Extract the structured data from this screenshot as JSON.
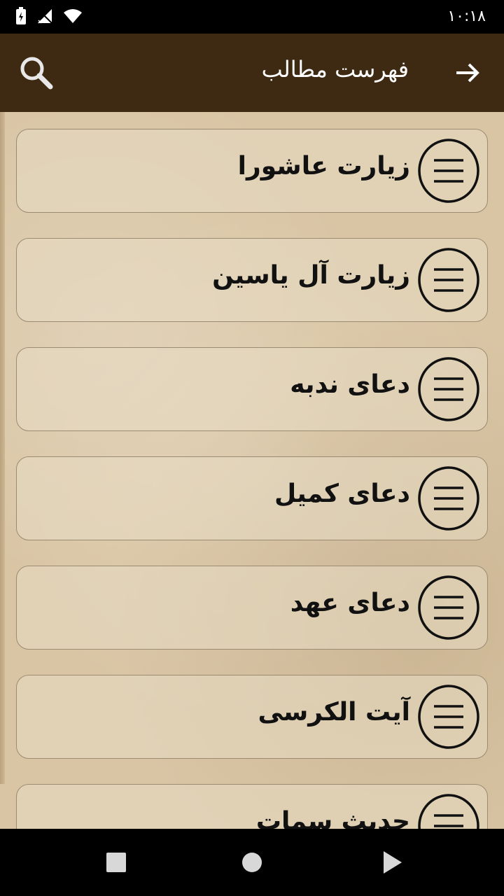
{
  "status_bar": {
    "time": "۱۰:۱۸",
    "icons": [
      "battery-charging-icon",
      "signal-off-icon",
      "wifi-icon"
    ]
  },
  "app_bar": {
    "title": "فهرست مطالب",
    "search_icon": "search-icon",
    "back_icon": "arrow-right-icon",
    "background_color": "#3e2a12"
  },
  "list": {
    "items": [
      {
        "label": "زیارت عاشورا"
      },
      {
        "label": "زیارت آل یاسین"
      },
      {
        "label": "دعای ندبه"
      },
      {
        "label": "دعای کمیل"
      },
      {
        "label": "دعای عهد"
      },
      {
        "label": "آیت الکرسی"
      },
      {
        "label": "حدیث سمات"
      }
    ],
    "item_icon": "menu-lines-icon"
  },
  "nav_bar": {
    "icons": [
      "recents-square-icon",
      "home-circle-icon",
      "back-triangle-icon"
    ]
  }
}
